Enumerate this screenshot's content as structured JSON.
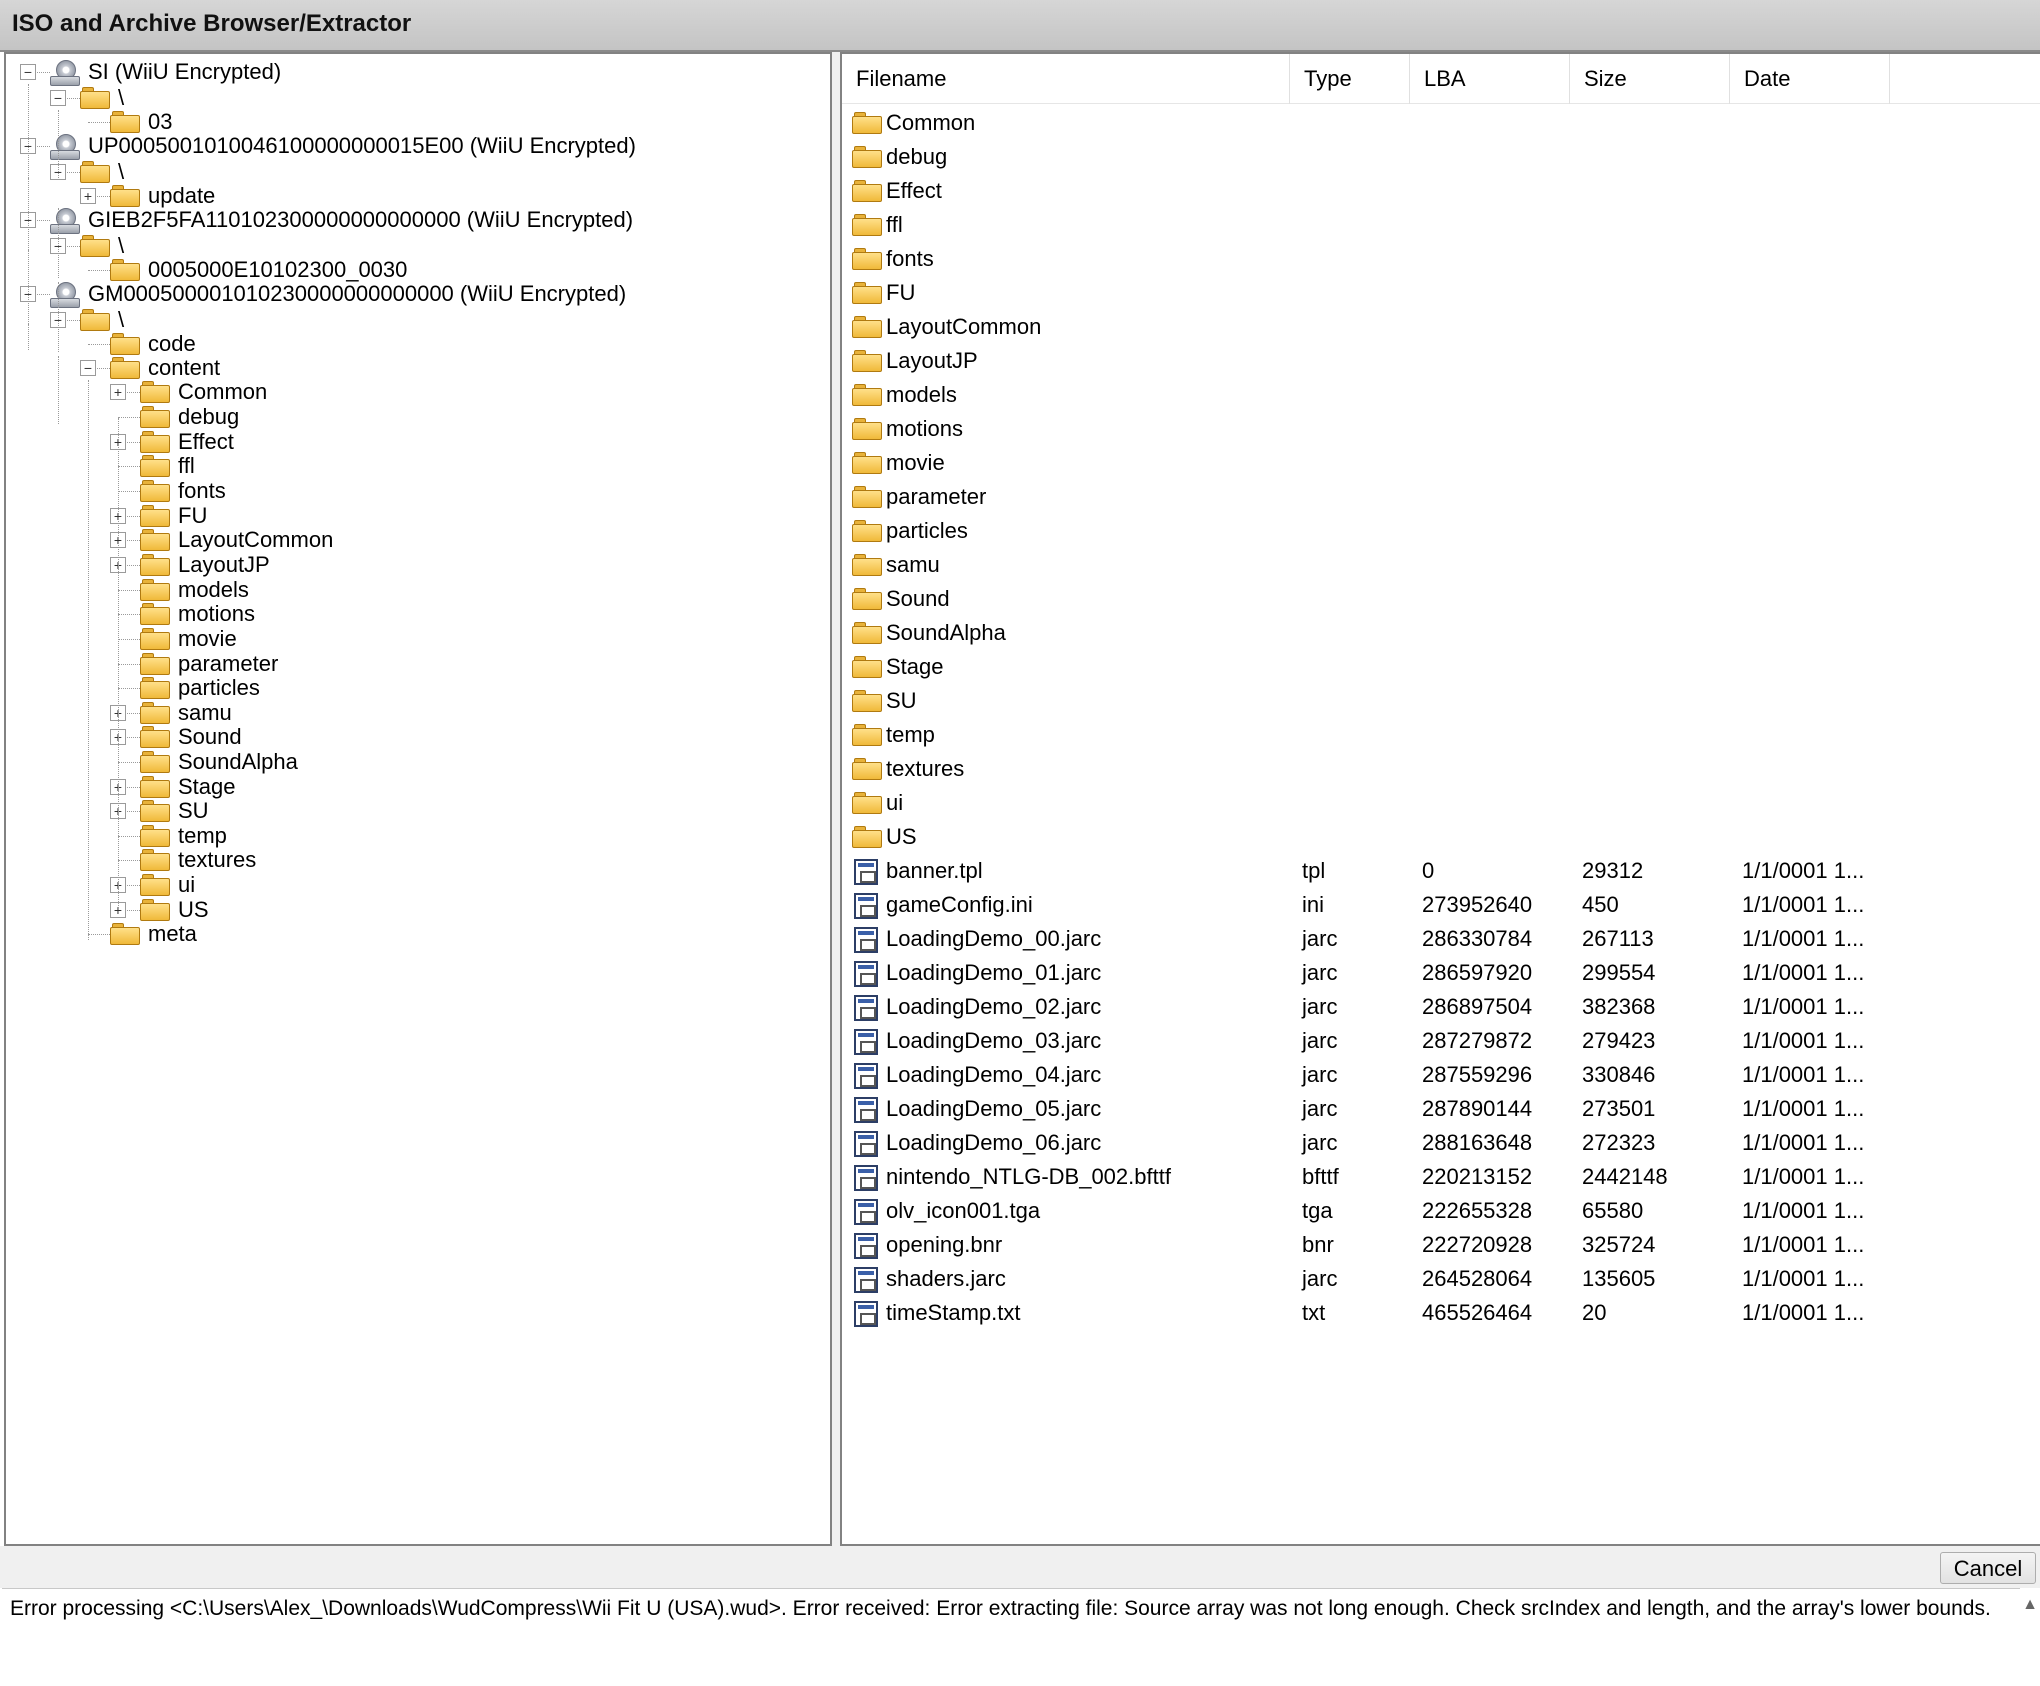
{
  "window": {
    "title": "ISO and Archive Browser/Extractor"
  },
  "tree": {
    "nodes": [
      {
        "label": "SI (WiiU Encrypted)",
        "icon": "drive-icon",
        "expander": "minus"
      },
      {
        "label": "\\",
        "icon": "folder-icon",
        "expander": "minus"
      },
      {
        "label": "03",
        "icon": "folder-icon",
        "expander": "none"
      },
      {
        "label": "UP0005001010046100000000015E00 (WiiU Encrypted)",
        "icon": "drive-icon",
        "expander": "minus"
      },
      {
        "label": "\\",
        "icon": "folder-icon",
        "expander": "minus"
      },
      {
        "label": "update",
        "icon": "folder-icon",
        "expander": "plus"
      },
      {
        "label": "GIEB2F5FA110102300000000000000 (WiiU Encrypted)",
        "icon": "drive-icon",
        "expander": "minus"
      },
      {
        "label": "\\",
        "icon": "folder-icon",
        "expander": "minus"
      },
      {
        "label": "0005000E10102300_0030",
        "icon": "folder-icon",
        "expander": "none"
      },
      {
        "label": "GM000500001010230000000000000 (WiiU Encrypted)",
        "icon": "drive-icon",
        "expander": "minus"
      },
      {
        "label": "\\",
        "icon": "folder-icon",
        "expander": "minus"
      },
      {
        "label": "code",
        "icon": "folder-icon",
        "expander": "none"
      },
      {
        "label": "content",
        "icon": "folder-icon",
        "expander": "minus"
      },
      {
        "label": "Common",
        "icon": "folder-icon",
        "expander": "plus"
      },
      {
        "label": "debug",
        "icon": "folder-icon",
        "expander": "none"
      },
      {
        "label": "Effect",
        "icon": "folder-icon",
        "expander": "plus"
      },
      {
        "label": "ffl",
        "icon": "folder-icon",
        "expander": "none"
      },
      {
        "label": "fonts",
        "icon": "folder-icon",
        "expander": "none"
      },
      {
        "label": "FU",
        "icon": "folder-icon",
        "expander": "plus"
      },
      {
        "label": "LayoutCommon",
        "icon": "folder-icon",
        "expander": "plus"
      },
      {
        "label": "LayoutJP",
        "icon": "folder-icon",
        "expander": "plus"
      },
      {
        "label": "models",
        "icon": "folder-icon",
        "expander": "none"
      },
      {
        "label": "motions",
        "icon": "folder-icon",
        "expander": "none"
      },
      {
        "label": "movie",
        "icon": "folder-icon",
        "expander": "none"
      },
      {
        "label": "parameter",
        "icon": "folder-icon",
        "expander": "none"
      },
      {
        "label": "particles",
        "icon": "folder-icon",
        "expander": "none"
      },
      {
        "label": "samu",
        "icon": "folder-icon",
        "expander": "plus"
      },
      {
        "label": "Sound",
        "icon": "folder-icon",
        "expander": "plus"
      },
      {
        "label": "SoundAlpha",
        "icon": "folder-icon",
        "expander": "none"
      },
      {
        "label": "Stage",
        "icon": "folder-icon",
        "expander": "plus"
      },
      {
        "label": "SU",
        "icon": "folder-icon",
        "expander": "plus"
      },
      {
        "label": "temp",
        "icon": "folder-icon",
        "expander": "none"
      },
      {
        "label": "textures",
        "icon": "folder-icon",
        "expander": "none"
      },
      {
        "label": "ui",
        "icon": "folder-icon",
        "expander": "plus"
      },
      {
        "label": "US",
        "icon": "folder-icon",
        "expander": "plus"
      },
      {
        "label": "meta",
        "icon": "folder-icon",
        "expander": "none"
      }
    ]
  },
  "list": {
    "columns": [
      "Filename",
      "Type",
      "LBA",
      "Size",
      "Date"
    ],
    "folders": [
      "Common",
      "debug",
      "Effect",
      "ffl",
      "fonts",
      "FU",
      "LayoutCommon",
      "LayoutJP",
      "models",
      "motions",
      "movie",
      "parameter",
      "particles",
      "samu",
      "Sound",
      "SoundAlpha",
      "Stage",
      "SU",
      "temp",
      "textures",
      "ui",
      "US"
    ],
    "files": [
      {
        "name": "banner.tpl",
        "type": "tpl",
        "lba": "0",
        "size": "29312",
        "date": "1/1/0001 1..."
      },
      {
        "name": "gameConfig.ini",
        "type": "ini",
        "lba": "273952640",
        "size": "450",
        "date": "1/1/0001 1..."
      },
      {
        "name": "LoadingDemo_00.jarc",
        "type": "jarc",
        "lba": "286330784",
        "size": "267113",
        "date": "1/1/0001 1..."
      },
      {
        "name": "LoadingDemo_01.jarc",
        "type": "jarc",
        "lba": "286597920",
        "size": "299554",
        "date": "1/1/0001 1..."
      },
      {
        "name": "LoadingDemo_02.jarc",
        "type": "jarc",
        "lba": "286897504",
        "size": "382368",
        "date": "1/1/0001 1..."
      },
      {
        "name": "LoadingDemo_03.jarc",
        "type": "jarc",
        "lba": "287279872",
        "size": "279423",
        "date": "1/1/0001 1..."
      },
      {
        "name": "LoadingDemo_04.jarc",
        "type": "jarc",
        "lba": "287559296",
        "size": "330846",
        "date": "1/1/0001 1..."
      },
      {
        "name": "LoadingDemo_05.jarc",
        "type": "jarc",
        "lba": "287890144",
        "size": "273501",
        "date": "1/1/0001 1..."
      },
      {
        "name": "LoadingDemo_06.jarc",
        "type": "jarc",
        "lba": "288163648",
        "size": "272323",
        "date": "1/1/0001 1..."
      },
      {
        "name": "nintendo_NTLG-DB_002.bfttf",
        "type": "bfttf",
        "lba": "220213152",
        "size": "2442148",
        "date": "1/1/0001 1..."
      },
      {
        "name": "olv_icon001.tga",
        "type": "tga",
        "lba": "222655328",
        "size": "65580",
        "date": "1/1/0001 1..."
      },
      {
        "name": "opening.bnr",
        "type": "bnr",
        "lba": "222720928",
        "size": "325724",
        "date": "1/1/0001 1..."
      },
      {
        "name": "shaders.jarc",
        "type": "jarc",
        "lba": "264528064",
        "size": "135605",
        "date": "1/1/0001 1..."
      },
      {
        "name": "timeStamp.txt",
        "type": "txt",
        "lba": "465526464",
        "size": "20",
        "date": "1/1/0001 1..."
      }
    ]
  },
  "footer": {
    "cancel_label": "Cancel",
    "message": "Error processing <C:\\Users\\Alex_\\Downloads\\WudCompress\\Wii Fit U (USA).wud>.  Error received: Error extracting file: Source array was not long enough. Check srcIndex and length, and the array's lower bounds."
  },
  "colors": {
    "folder": "#f0b93a",
    "title_bar": "#c8c8c8",
    "border": "#828282"
  }
}
